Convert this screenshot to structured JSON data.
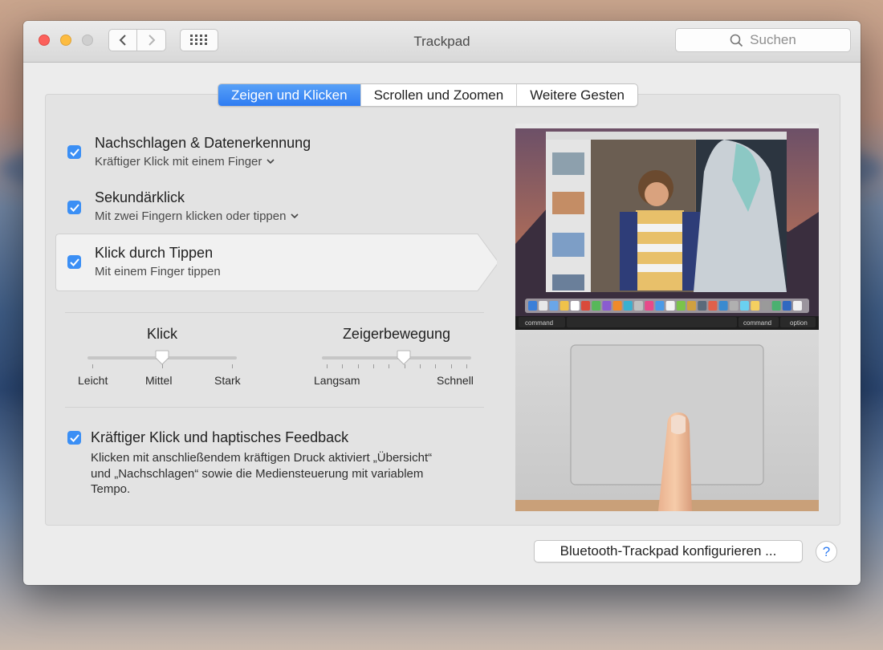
{
  "window": {
    "title": "Trackpad"
  },
  "search": {
    "placeholder": "Suchen",
    "icon": "search-icon"
  },
  "tabs": [
    {
      "label": "Zeigen und Klicken",
      "active": true
    },
    {
      "label": "Scrollen und Zoomen",
      "active": false
    },
    {
      "label": "Weitere Gesten",
      "active": false
    }
  ],
  "options": [
    {
      "title": "Nachschlagen & Datenerkennung",
      "subtitle": "Kräftiger Klick mit einem Finger",
      "has_menu": true,
      "checked": true
    },
    {
      "title": "Sekundärklick",
      "subtitle": "Mit zwei Fingern klicken oder tippen",
      "has_menu": true,
      "checked": true
    },
    {
      "title": "Klick durch Tippen",
      "subtitle": "Mit einem Finger tippen",
      "has_menu": false,
      "checked": true,
      "selected": true
    }
  ],
  "sliders": {
    "click": {
      "title": "Klick",
      "labels": [
        "Leicht",
        "Mittel",
        "Stark"
      ],
      "value": 0.5,
      "steps": 3
    },
    "pointer": {
      "title": "Zeigerbewegung",
      "labels": [
        "Langsam",
        "Schnell"
      ],
      "value": 0.55,
      "steps": 10
    }
  },
  "force_touch": {
    "title": "Kräftiger Klick und haptisches Feedback",
    "checked": true,
    "description_line1": "Klicken mit anschließendem kräftigen Druck aktiviert „Übersicht“",
    "description_line2": "und „Nachschlagen“ sowie die Mediensteuerung mit variablem",
    "description_line3": "Tempo."
  },
  "preview": {
    "keys": [
      "command",
      "command",
      "option"
    ]
  },
  "buttons": {
    "bluetooth": "Bluetooth-Trackpad konfigurieren ...",
    "help": "?"
  },
  "colors": {
    "accent": "#3b8ff5",
    "tab_active": "#2f7cf2"
  }
}
